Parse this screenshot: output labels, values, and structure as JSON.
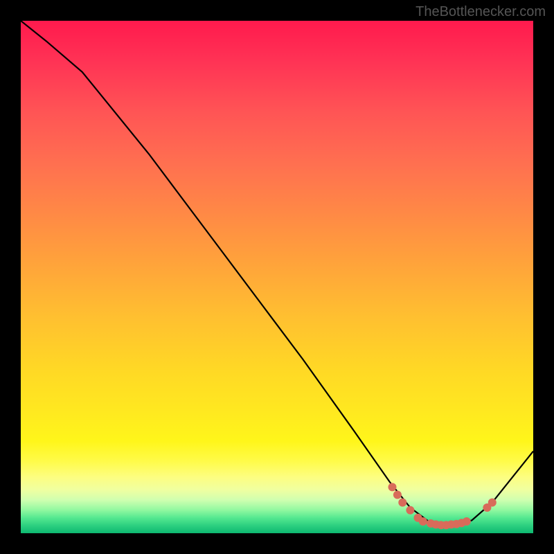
{
  "watermark": "TheBottlenecker.com",
  "chart_data": {
    "type": "line",
    "title": "",
    "xlabel": "",
    "ylabel": "",
    "xlim": [
      0,
      100
    ],
    "ylim": [
      0,
      100
    ],
    "background_gradient": {
      "top": "#ff1a4d",
      "mid": "#ffe820",
      "bottom": "#0db870"
    },
    "curve": {
      "description": "Monotone curve descending from top-left, flattening near bottom around x≈78–88, then rising toward the right edge. Minimum (optimal/zero-bottleneck zone) near x≈82.",
      "points": [
        {
          "x": 0,
          "y": 100
        },
        {
          "x": 5,
          "y": 96
        },
        {
          "x": 12,
          "y": 90
        },
        {
          "x": 25,
          "y": 74
        },
        {
          "x": 40,
          "y": 54
        },
        {
          "x": 55,
          "y": 34
        },
        {
          "x": 65,
          "y": 20
        },
        {
          "x": 72,
          "y": 10
        },
        {
          "x": 76,
          "y": 5
        },
        {
          "x": 80,
          "y": 2
        },
        {
          "x": 84,
          "y": 1.5
        },
        {
          "x": 88,
          "y": 2.5
        },
        {
          "x": 92,
          "y": 6
        },
        {
          "x": 96,
          "y": 11
        },
        {
          "x": 100,
          "y": 16
        }
      ]
    },
    "markers": {
      "color": "#d86b5a",
      "radius": 6,
      "points": [
        {
          "x": 72.5,
          "y": 9
        },
        {
          "x": 73.5,
          "y": 7.5
        },
        {
          "x": 74.5,
          "y": 6
        },
        {
          "x": 76,
          "y": 4.5
        },
        {
          "x": 77.5,
          "y": 3
        },
        {
          "x": 78.5,
          "y": 2.3
        },
        {
          "x": 80,
          "y": 1.9
        },
        {
          "x": 81,
          "y": 1.7
        },
        {
          "x": 82,
          "y": 1.6
        },
        {
          "x": 83,
          "y": 1.6
        },
        {
          "x": 84,
          "y": 1.7
        },
        {
          "x": 85,
          "y": 1.8
        },
        {
          "x": 86,
          "y": 2.0
        },
        {
          "x": 87,
          "y": 2.3
        },
        {
          "x": 91,
          "y": 5
        },
        {
          "x": 92,
          "y": 6
        }
      ]
    }
  }
}
